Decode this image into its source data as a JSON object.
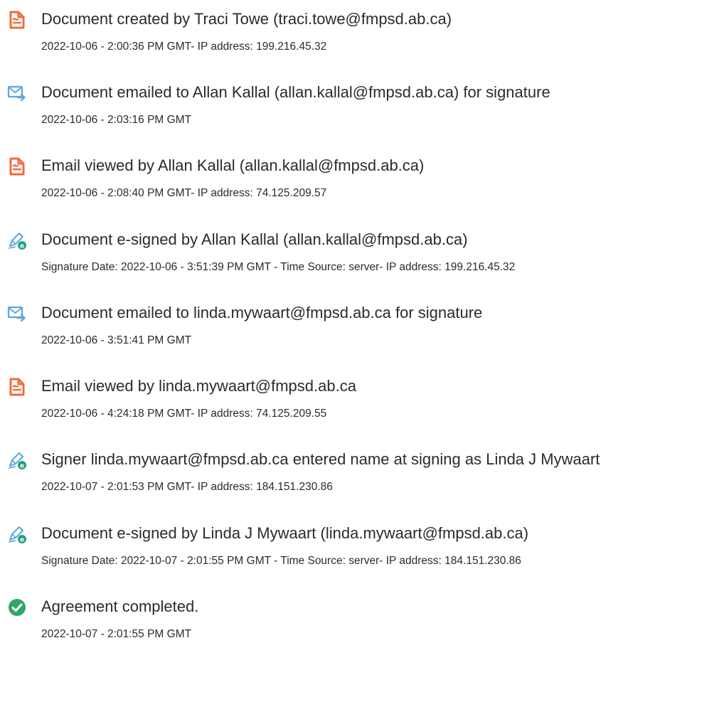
{
  "events": [
    {
      "icon": "document-created-icon",
      "title": "Document created by Traci Towe (traci.towe@fmpsd.ab.ca)",
      "meta": "2022-10-06 - 2:00:36 PM GMT- IP address: 199.216.45.32"
    },
    {
      "icon": "document-emailed-icon",
      "title": "Document emailed to Allan Kallal (allan.kallal@fmpsd.ab.ca) for signature",
      "meta": "2022-10-06 - 2:03:16 PM GMT"
    },
    {
      "icon": "email-viewed-icon",
      "title": "Email viewed by Allan Kallal (allan.kallal@fmpsd.ab.ca)",
      "meta": "2022-10-06 - 2:08:40 PM GMT- IP address: 74.125.209.57"
    },
    {
      "icon": "e-signed-pen-icon",
      "title": "Document e-signed by Allan Kallal (allan.kallal@fmpsd.ab.ca)",
      "meta": "Signature Date: 2022-10-06 - 3:51:39 PM GMT - Time Source: server- IP address: 199.216.45.32"
    },
    {
      "icon": "document-emailed-icon",
      "title": "Document emailed to linda.mywaart@fmpsd.ab.ca for signature",
      "meta": "2022-10-06 - 3:51:41 PM GMT"
    },
    {
      "icon": "email-viewed-icon",
      "title": "Email viewed by linda.mywaart@fmpsd.ab.ca",
      "meta": "2022-10-06 - 4:24:18 PM GMT- IP address: 74.125.209.55"
    },
    {
      "icon": "e-signed-pen-icon",
      "title": "Signer linda.mywaart@fmpsd.ab.ca entered name at signing as Linda J Mywaart",
      "meta": "2022-10-07 - 2:01:53 PM GMT- IP address: 184.151.230.86"
    },
    {
      "icon": "e-signed-pen-icon",
      "title": "Document e-signed by Linda J Mywaart (linda.mywaart@fmpsd.ab.ca)",
      "meta": "Signature Date: 2022-10-07 - 2:01:55 PM GMT - Time Source: server- IP address: 184.151.230.86"
    },
    {
      "icon": "agreement-completed-check-icon",
      "title": "Agreement completed.",
      "meta": "2022-10-07 - 2:01:55 PM GMT"
    }
  ],
  "colors": {
    "document_orange": "#f26b3a",
    "email_blue": "#5aa6e0",
    "pen_green": "#1ea37a",
    "check_green": "#2fa66b",
    "text": "#2b2b2b"
  }
}
